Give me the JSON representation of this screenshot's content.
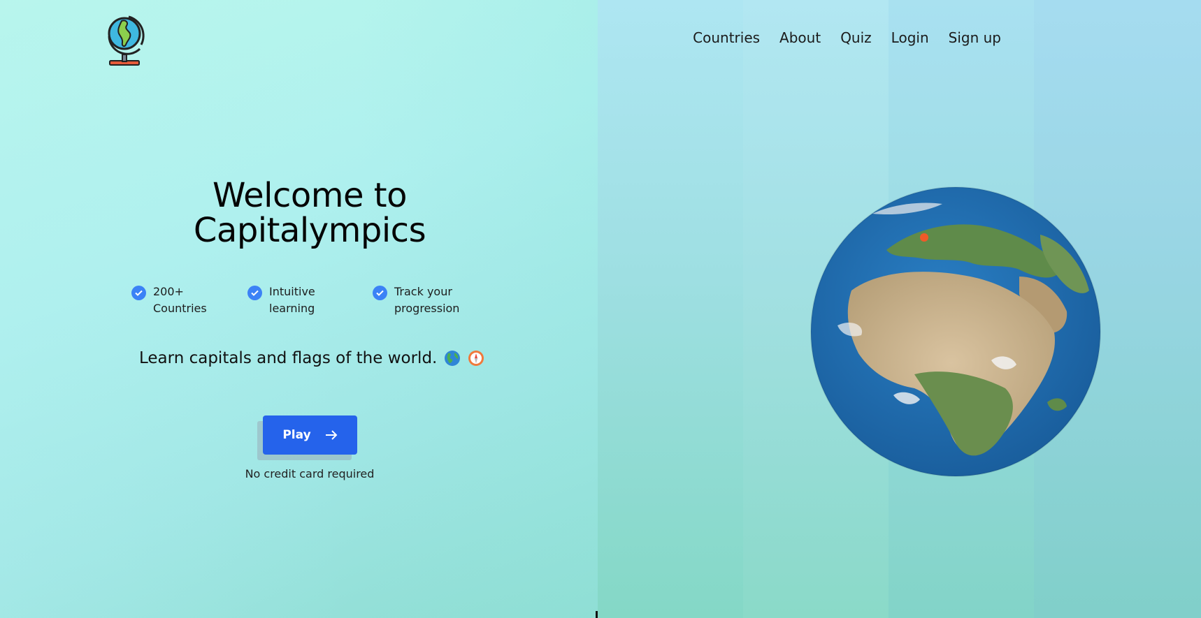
{
  "brand": {
    "logo_icon": "globe-icon"
  },
  "nav": {
    "items": [
      "Countries",
      "About",
      "Quiz",
      "Login",
      "Sign up"
    ]
  },
  "hero": {
    "title_line1": "Welcome to",
    "title_line2": "Capitalympics",
    "features": [
      {
        "icon": "check-circle-icon",
        "label": "200+ Countries"
      },
      {
        "icon": "check-circle-icon",
        "label": "Intuitive learning"
      },
      {
        "icon": "check-circle-icon",
        "label": "Track your progression"
      }
    ],
    "tagline": "Learn capitals and flags of the world.",
    "tagline_icons": [
      "earth-globe-icon",
      "compass-icon"
    ],
    "play_label": "Play",
    "play_icon": "arrow-right-icon",
    "note": "No credit card required"
  },
  "visual": {
    "globe": "earth-globe-image",
    "marker": "location-dot-icon"
  },
  "colors": {
    "accent": "#2563eb",
    "check": "#3b82f6",
    "marker": "#f05a28"
  }
}
